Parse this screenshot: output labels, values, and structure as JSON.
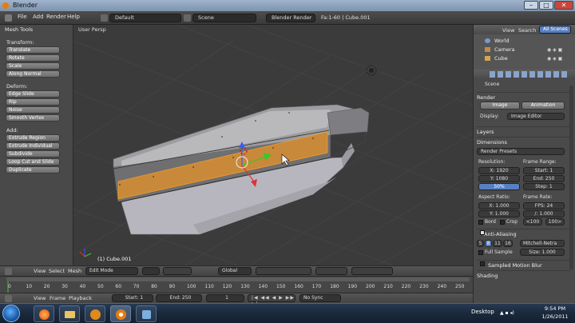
{
  "window": {
    "title": "Blender"
  },
  "menu": {
    "items": [
      "File",
      "Add",
      "Render",
      "Help"
    ],
    "layout": "Default",
    "scene": "Scene",
    "engine": "Blender Render",
    "info": "Fa:1-60 | Cube.001"
  },
  "toolshelf": {
    "header": "Mesh Tools",
    "transform_label": "Transform:",
    "transform": [
      "Translate",
      "Rotate",
      "Scale",
      "Along Normal"
    ],
    "deform_label": "Deform:",
    "deform": [
      "Edge Slide",
      "Rip",
      "Noise",
      "Smooth Vertex"
    ],
    "add_label": "Add:",
    "add": [
      "Extrude Region",
      "Extrude Individual",
      "Subdivide",
      "Loop Cut and Slide",
      "Duplicate"
    ]
  },
  "viewport": {
    "view_label": "User Persp",
    "object_label": "(1) Cube.001"
  },
  "view_header": {
    "menus": [
      "View",
      "Select",
      "Mesh"
    ],
    "mode": "Edit Mode",
    "orientation": "Global"
  },
  "timeline": {
    "ticks": [
      "0",
      "10",
      "20",
      "30",
      "40",
      "50",
      "60",
      "70",
      "80",
      "90",
      "100",
      "110",
      "120",
      "130",
      "140",
      "150",
      "160",
      "170",
      "180",
      "190",
      "200",
      "210",
      "220",
      "230",
      "240",
      "250"
    ],
    "menus": [
      "View",
      "Frame",
      "Playback"
    ],
    "start": "Start: 1",
    "end": "End: 250",
    "current": "1",
    "sync": "No Sync"
  },
  "outliner": {
    "menus": [
      "View",
      "Search"
    ],
    "scenes": "All Scenes",
    "items": [
      "World",
      "Camera",
      "Cube"
    ]
  },
  "properties": {
    "context": "Scene",
    "render_section": "Render",
    "image_button": "Image",
    "animation_button": "Animation",
    "display_label": "Display:",
    "display_value": "Image Editor",
    "layers_section": "Layers",
    "dimensions_section": "Dimensions",
    "presets": "Render Presets",
    "resolution_label": "Resolution:",
    "res_x": "X: 1920",
    "res_y": "Y: 1080",
    "res_pct": "50%",
    "frame_range_label": "Frame Range:",
    "start": "Start: 1",
    "end": "End: 250",
    "step": "Step: 1",
    "aspect_label": "Aspect Ratio:",
    "aspect_x": "X: 1.000",
    "aspect_y": "Y: 1.000",
    "frame_rate_label": "Frame Rate:",
    "fps": "FPS: 24",
    "fps_base": "/: 1.000",
    "bord": "Bord",
    "crop": "Crop",
    "old": "<100",
    "new": "100>",
    "aa_section": "Anti-Aliasing",
    "aa_samples": [
      "5",
      "8",
      "11",
      "16"
    ],
    "aa_filter": "Mitchell-Netra",
    "full_sample": "Full Sample",
    "size": "Size: 1.000",
    "motion_blur_section": "Sampled Motion Blur",
    "shading_section": "Shading"
  },
  "taskbar": {
    "desktop_label": "Desktop",
    "time": "9:54 PM",
    "date": "1/26/2011"
  },
  "colors": {
    "viewport_bg": "#3b3b3b",
    "selected_face": "#c8893a",
    "panel": "#4a4a4a",
    "accent_blue": "#5680c2"
  }
}
